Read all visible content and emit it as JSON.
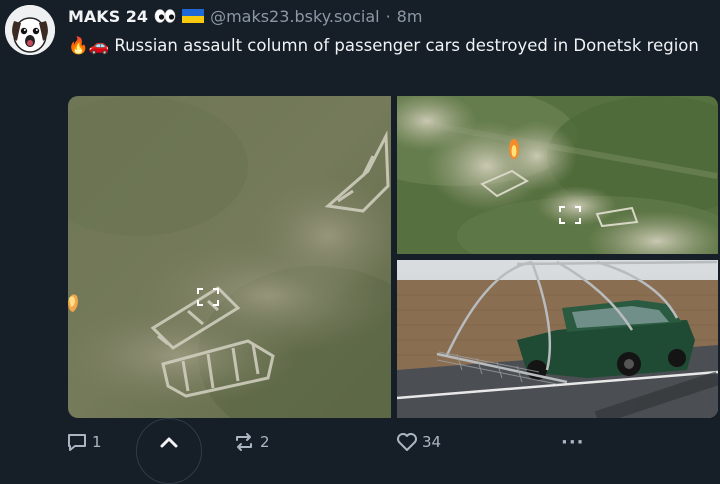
{
  "post": {
    "display_name": "MAKS 24",
    "eyes_icon": "eyes-emoji",
    "flag_icon": "ukraine-flag",
    "handle": "@maks23.bsky.social",
    "separator": "·",
    "time": "8m",
    "text_emoji": "🔥🚗",
    "text": "Russian assault column of passenger cars destroyed in Donetsk region"
  },
  "media": {
    "images": [
      "drone-view-burning-vehicles",
      "drone-view-smoke-column",
      "car-with-cage-armor"
    ]
  },
  "actions": {
    "reply_count": "1",
    "repost_count": "2",
    "like_count": "34",
    "more_label": "···"
  },
  "colors": {
    "background": "#161e27",
    "text": "#f1f3f5",
    "muted": "#8b98a5",
    "action": "#aab6c3"
  }
}
